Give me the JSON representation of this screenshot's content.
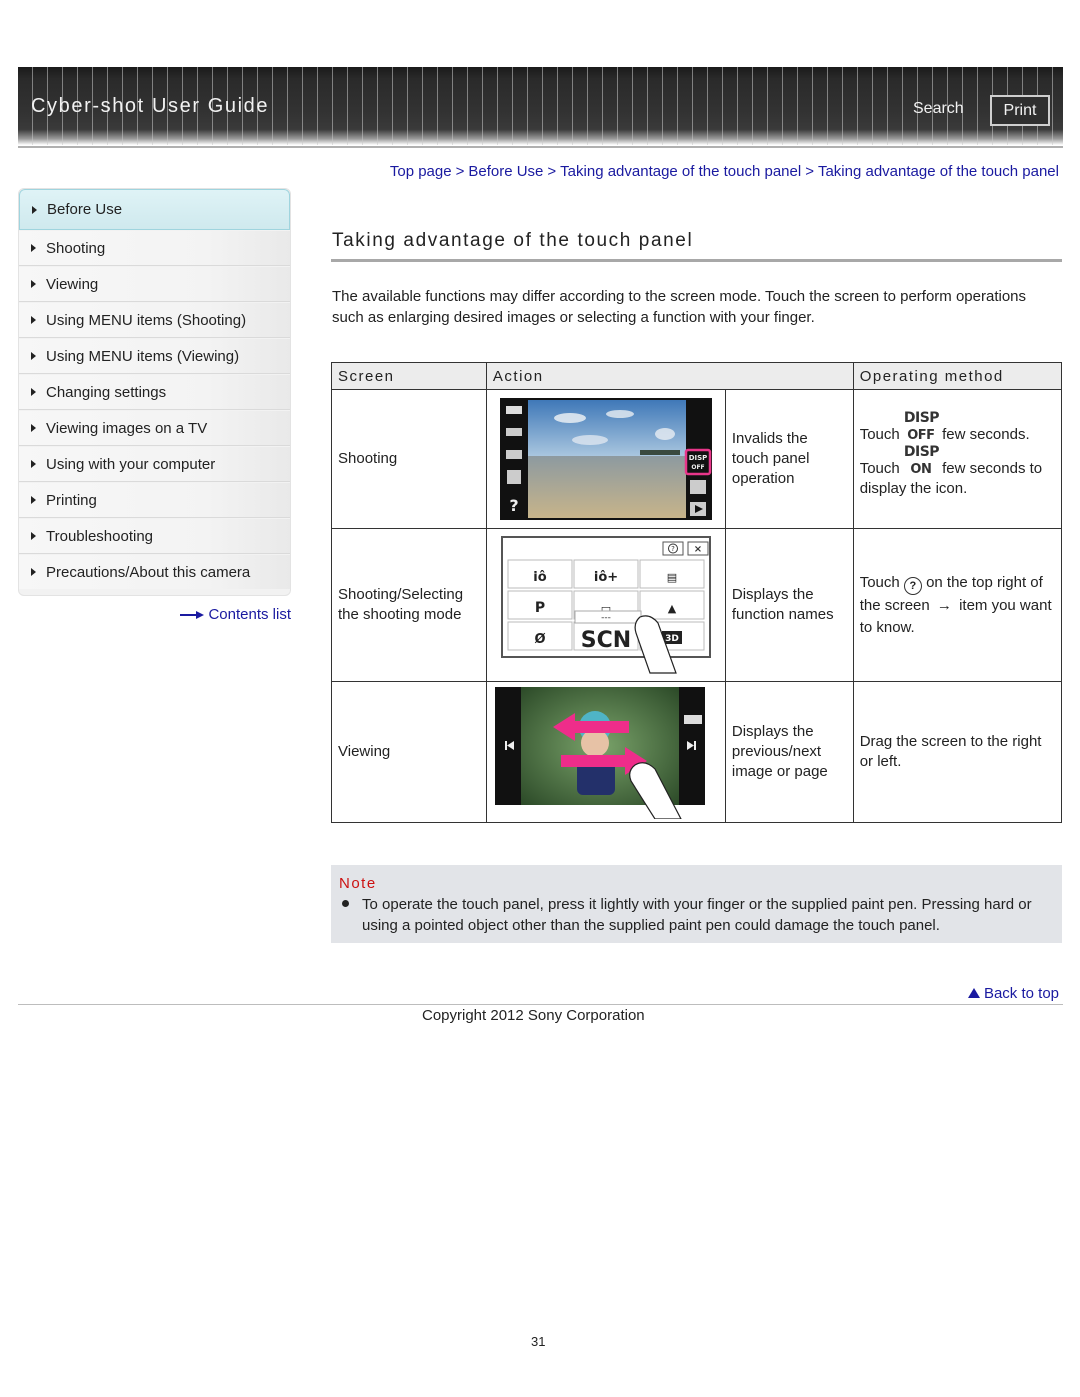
{
  "header": {
    "app_title": "Cyber-shot User Guide",
    "search_label": "Search",
    "print_label": "Print"
  },
  "breadcrumb": {
    "items": [
      "Top page",
      "Before Use",
      "Taking advantage of the touch panel",
      "Taking advantage of the touch panel"
    ],
    "separator": ">"
  },
  "sidebar": {
    "items": [
      {
        "label": "Before Use",
        "active": true
      },
      {
        "label": "Shooting"
      },
      {
        "label": "Viewing"
      },
      {
        "label": "Using MENU items (Shooting)"
      },
      {
        "label": "Using MENU items (Viewing)"
      },
      {
        "label": "Changing settings"
      },
      {
        "label": "Viewing images on a TV"
      },
      {
        "label": "Using with your computer"
      },
      {
        "label": "Printing"
      },
      {
        "label": "Troubleshooting"
      },
      {
        "label": "Precautions/About this camera"
      }
    ],
    "contents_link": "Contents list"
  },
  "main": {
    "title": "Taking advantage of the touch panel",
    "intro": "The available functions may differ according to the screen mode. Touch the screen to perform operations such as enlarging desired images or selecting a function with your finger.",
    "table": {
      "headers": [
        "Screen",
        "Action",
        "Operating method"
      ],
      "rows": [
        {
          "screen": "Shooting",
          "action": "Invalids the touch panel operation",
          "method_line1_pre": "Touch",
          "method_icon1_top": "DISP",
          "method_icon1_bottom": "OFF",
          "method_line1_post": "few seconds.",
          "method_line2_pre": "Touch",
          "method_icon2_top": "DISP",
          "method_icon2_bottom": "ON",
          "method_line2_post": "few seconds to display the icon.",
          "image_labels": {
            "menu": "MENU",
            "disp": "DISP",
            "disp_state": "OFF",
            "help": "?"
          }
        },
        {
          "screen": "Shooting/Selecting the shooting mode",
          "action": "Displays the function names",
          "method_pre": "Touch",
          "method_icon": "?",
          "method_post": "on the top right of the screen",
          "method_arrow": "→",
          "method_end": "item you want to know.",
          "image_labels": {
            "help": "?",
            "close": "×",
            "cells": [
              "iô",
              "iô+",
              "",
              "P",
              "",
              "",
              "Ø",
              "SCN",
              "3D"
            ],
            "placeholder": "---"
          }
        },
        {
          "screen": "Viewing",
          "action": "Displays the previous/next image or page",
          "method": "Drag the screen to the right or left.",
          "image_labels": {
            "prev": "|◀",
            "next": "▶|"
          }
        }
      ]
    },
    "note": {
      "title": "Note",
      "text": "To operate the touch panel, press it lightly with your finger or the supplied paint pen. Pressing hard or using a pointed object other than the supplied paint pen could damage the touch panel."
    },
    "back_to_top": "Back to top"
  },
  "footer": {
    "copyright": "Copyright 2012 Sony Corporation",
    "page_number": "31"
  },
  "colors": {
    "link": "#1a1aa0",
    "note_title": "#cc1111",
    "note_bg": "#e2e4e8",
    "highlight_pink": "#e8368a"
  }
}
